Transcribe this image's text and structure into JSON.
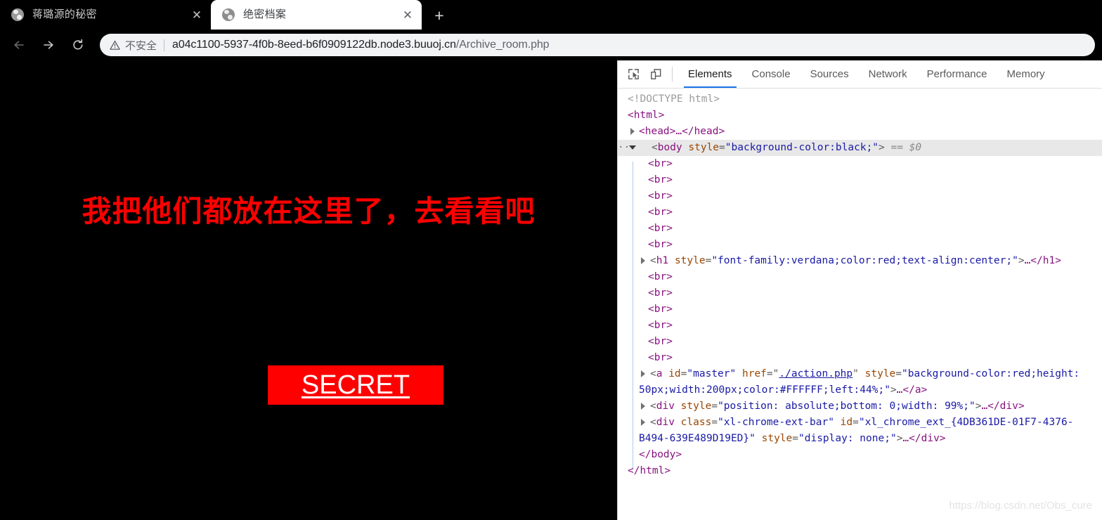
{
  "browser": {
    "tabs": [
      {
        "title": "蒋璐源的秘密",
        "active": false,
        "close_label": "✕",
        "favicon": "globe-icon"
      },
      {
        "title": "绝密档案",
        "active": true,
        "close_label": "✕",
        "favicon": "globe-icon"
      }
    ],
    "new_tab_label": "+",
    "nav": {
      "back_icon": "arrow-left-icon",
      "forward_icon": "arrow-right-icon",
      "reload_icon": "reload-icon"
    },
    "omnibox": {
      "security_icon": "warning-triangle-icon",
      "security_label": "不安全",
      "url_host": "a04c1100-5937-4f0b-8eed-b6f0909122db.node3.buuoj.cn",
      "url_path": "/Archive_room.php"
    }
  },
  "page": {
    "heading": "我把他们都放在这里了，去看看吧",
    "secret_button_label": "SECRET",
    "background_color": "#000000",
    "heading_color": "#ff0000",
    "button_color": "#ff0000",
    "button_text_color": "#FFFFFF"
  },
  "devtools": {
    "toolbar_icons": [
      {
        "name": "inspect-element-icon"
      },
      {
        "name": "device-toolbar-icon"
      }
    ],
    "tabs": [
      {
        "label": "Elements",
        "active": true
      },
      {
        "label": "Console",
        "active": false
      },
      {
        "label": "Sources",
        "active": false
      },
      {
        "label": "Network",
        "active": false
      },
      {
        "label": "Performance",
        "active": false
      },
      {
        "label": "Memory",
        "active": false
      }
    ],
    "dom": {
      "doctype": "<!DOCTYPE html>",
      "html_open": "<html>",
      "head_collapsed": "<head>…</head>",
      "body_tag": "body",
      "body_attr_name": "style",
      "body_attr_value": "\"background-color:black;\"",
      "body_selection": "== $0",
      "br_tag": "<br>",
      "br_count_before_h1": 6,
      "br_count_after_h1": 6,
      "h1_tag": "h1",
      "h1_attr_name": "style",
      "h1_attr_value": "\"font-family:verdana;color:red;text-align:center;\"",
      "h1_close": "…</h1>",
      "a_tag": "a",
      "a_id_name": "id",
      "a_id_value": "\"master\"",
      "a_href_name": "href",
      "a_href_value": "./action.php",
      "a_style_name": "style",
      "a_style_value_part1": "\"background-color:red;height:",
      "a_style_value_part2": "50px;width:200px;color:#FFFFFF;left:44%;\"",
      "a_close": "…</a>",
      "div1_tag": "div",
      "div1_attr_name": "style",
      "div1_attr_value": "\"position: absolute;bottom: 0;width: 99%;\"",
      "div1_close": "…</div>",
      "div2_tag": "div",
      "div2_class_name": "class",
      "div2_class_value": "\"xl-chrome-ext-bar\"",
      "div2_id_name": "id",
      "div2_id_value_part1": "\"xl_chrome_ext_{4DB361DE-01F7-4376-",
      "div2_id_value_part2": "B494-639E489D19ED}\"",
      "div2_style_name": "style",
      "div2_style_value": "\"display: none;\"",
      "div2_close": "…</div>",
      "body_close": "</body>",
      "html_close": "</html>"
    }
  },
  "watermark": "https://blog.csdn.net/Obs_cure"
}
